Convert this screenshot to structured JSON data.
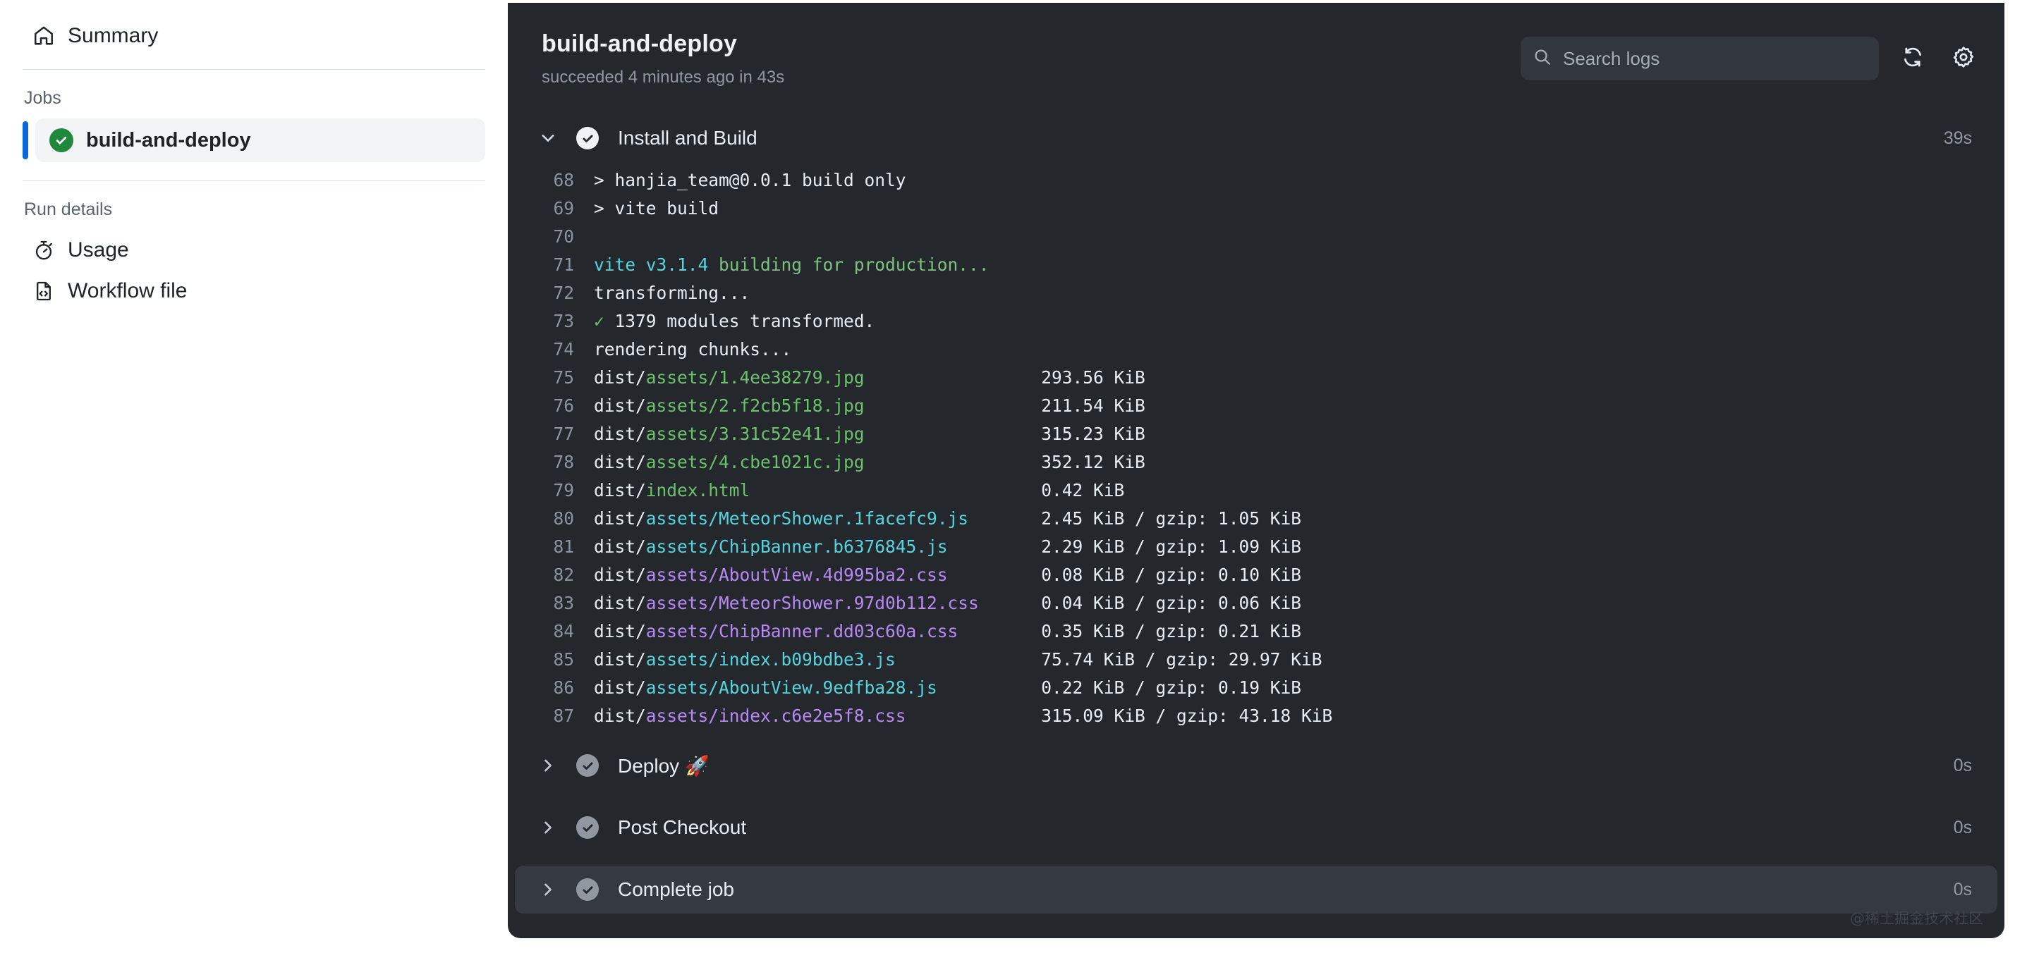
{
  "sidebar": {
    "summary": {
      "label": "Summary",
      "icon": "home-icon"
    },
    "jobs_heading": "Jobs",
    "jobs": [
      {
        "label": "build-and-deploy",
        "status": "succeeded"
      }
    ],
    "run_details_heading": "Run details",
    "run_details": [
      {
        "label": "Usage",
        "icon": "stopwatch-icon"
      },
      {
        "label": "Workflow file",
        "icon": "workflow-file-icon"
      }
    ]
  },
  "header": {
    "title": "build-and-deploy",
    "subtitle": "succeeded 4 minutes ago in 43s",
    "search": {
      "placeholder": "Search logs",
      "value": ""
    },
    "refresh_icon": "refresh-icon",
    "settings_icon": "gear-icon"
  },
  "steps": [
    {
      "name": "Install and Build",
      "duration": "39s",
      "expanded": true,
      "status": "success",
      "active": false
    },
    {
      "name": "Deploy 🚀",
      "duration": "0s",
      "expanded": false,
      "status": "success",
      "active": false
    },
    {
      "name": "Post Checkout",
      "duration": "0s",
      "expanded": false,
      "status": "success",
      "active": false
    },
    {
      "name": "Complete job",
      "duration": "0s",
      "expanded": false,
      "status": "success",
      "active": true
    }
  ],
  "log": {
    "lines": [
      {
        "n": "68",
        "clipped": true,
        "segments": [
          {
            "t": "> hanjia_team@0.0.1 build only",
            "c": "plain"
          }
        ]
      },
      {
        "n": "69",
        "segments": [
          {
            "t": "> vite build",
            "c": "plain"
          }
        ]
      },
      {
        "n": "70",
        "segments": [
          {
            "t": "",
            "c": "plain"
          }
        ]
      },
      {
        "n": "71",
        "segments": [
          {
            "t": "vite v3.1.4",
            "c": "cyan"
          },
          {
            "t": " building for production...",
            "c": "green"
          }
        ]
      },
      {
        "n": "72",
        "segments": [
          {
            "t": "transforming...",
            "c": "plain"
          }
        ]
      },
      {
        "n": "73",
        "segments": [
          {
            "t": "✓",
            "c": "green"
          },
          {
            "t": " 1379 modules transformed.",
            "c": "plain"
          }
        ]
      },
      {
        "n": "74",
        "segments": [
          {
            "t": "rendering chunks...",
            "c": "plain"
          }
        ]
      },
      {
        "n": "75",
        "segments": [
          {
            "t": "dist/",
            "c": "plain"
          },
          {
            "t": "assets/1.4ee38279.jpg",
            "c": "green"
          }
        ],
        "size": "293.56 KiB"
      },
      {
        "n": "76",
        "segments": [
          {
            "t": "dist/",
            "c": "plain"
          },
          {
            "t": "assets/2.f2cb5f18.jpg",
            "c": "green"
          }
        ],
        "size": "211.54 KiB"
      },
      {
        "n": "77",
        "segments": [
          {
            "t": "dist/",
            "c": "plain"
          },
          {
            "t": "assets/3.31c52e41.jpg",
            "c": "green"
          }
        ],
        "size": "315.23 KiB"
      },
      {
        "n": "78",
        "segments": [
          {
            "t": "dist/",
            "c": "plain"
          },
          {
            "t": "assets/4.cbe1021c.jpg",
            "c": "green"
          }
        ],
        "size": "352.12 KiB"
      },
      {
        "n": "79",
        "segments": [
          {
            "t": "dist/",
            "c": "plain"
          },
          {
            "t": "index.html",
            "c": "green"
          }
        ],
        "size": "0.42 KiB"
      },
      {
        "n": "80",
        "segments": [
          {
            "t": "dist/",
            "c": "plain"
          },
          {
            "t": "assets/MeteorShower.1facefc9.js",
            "c": "cyan"
          }
        ],
        "size": "2.45 KiB / gzip: 1.05 KiB"
      },
      {
        "n": "81",
        "segments": [
          {
            "t": "dist/",
            "c": "plain"
          },
          {
            "t": "assets/ChipBanner.b6376845.js",
            "c": "cyan"
          }
        ],
        "size": "2.29 KiB / gzip: 1.09 KiB"
      },
      {
        "n": "82",
        "segments": [
          {
            "t": "dist/",
            "c": "plain"
          },
          {
            "t": "assets/AboutView.4d995ba2.css",
            "c": "purple"
          }
        ],
        "size": "0.08 KiB / gzip: 0.10 KiB"
      },
      {
        "n": "83",
        "segments": [
          {
            "t": "dist/",
            "c": "plain"
          },
          {
            "t": "assets/MeteorShower.97d0b112.css",
            "c": "purple"
          }
        ],
        "size": "0.04 KiB / gzip: 0.06 KiB"
      },
      {
        "n": "84",
        "segments": [
          {
            "t": "dist/",
            "c": "plain"
          },
          {
            "t": "assets/ChipBanner.dd03c60a.css",
            "c": "purple"
          }
        ],
        "size": "0.35 KiB / gzip: 0.21 KiB"
      },
      {
        "n": "85",
        "segments": [
          {
            "t": "dist/",
            "c": "plain"
          },
          {
            "t": "assets/index.b09bdbe3.js",
            "c": "cyan"
          }
        ],
        "size": "75.74 KiB / gzip: 29.97 KiB"
      },
      {
        "n": "86",
        "segments": [
          {
            "t": "dist/",
            "c": "plain"
          },
          {
            "t": "assets/AboutView.9edfba28.js",
            "c": "cyan"
          }
        ],
        "size": "0.22 KiB / gzip: 0.19 KiB"
      },
      {
        "n": "87",
        "segments": [
          {
            "t": "dist/",
            "c": "plain"
          },
          {
            "t": "assets/index.c6e2e5f8.css",
            "c": "purple"
          }
        ],
        "size": "315.09 KiB / gzip: 43.18 KiB"
      }
    ]
  },
  "watermark": "@稀土掘金技术社区",
  "colors": {
    "panel_bg": "#24282d",
    "step_active_bg": "#353a42",
    "accent_blue": "#0969da",
    "success_green": "#1f883d",
    "log_green": "#6cc26c",
    "log_cyan": "#56d4dd",
    "log_purple": "#b889f5",
    "muted_text": "#9198a1"
  }
}
